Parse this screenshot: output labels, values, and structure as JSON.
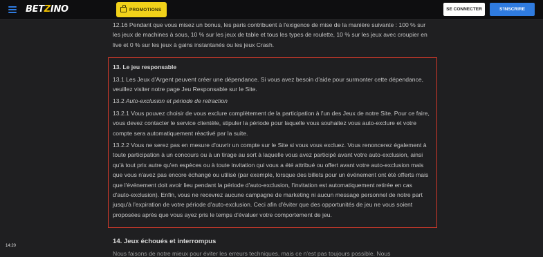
{
  "header": {
    "logo_main": "BET",
    "logo_accent": "Z",
    "logo_rest": "INO",
    "promo_label": "PROMOTIONS",
    "login_label": "SE CONNECTER",
    "signup_label": "S'INSCRIRE",
    "colors": {
      "accent_blue": "#2f7be0",
      "promo_yellow": "#f2d21a",
      "highlight_red": "#d63a2b"
    }
  },
  "content": {
    "p_12_16": "12.16 Pendant que vous misez un bonus, les paris contribuent à l'exigence de mise de la manière suivante : 100 % sur les jeux de machines à sous, 10 % sur les jeux de table et tous les types de roulette, 10 % sur les jeux avec croupier en live et 0 % sur les jeux à gains instantanés ou les jeux Crash.",
    "h_13": "13. Le jeu responsable",
    "p_13_1": "13.1 Les Jeux d'Argent peuvent créer une dépendance. Si vous avez besoin d'aide pour surmonter cette dépendance, veuillez visiter notre page Jeu Responsable sur le Site.",
    "h_13_2_num": "13.2",
    "h_13_2": "Auto-exclusion et période de retraction",
    "p_13_2_1": "13.2.1 Vous pouvez choisir de vous exclure complètement de la participation à l'un des Jeux de notre Site. Pour ce faire, vous devez contacter le service clientèle, stipuler la période pour laquelle vous souhaitez vous auto-exclure et votre compte sera automatiquement réactivé par la suite.",
    "p_13_2_2": "13.2.2 Vous ne serez pas en mesure d'ouvrir un compte sur le Site si vous vous excluez. Vous renoncerez également à toute participation à un concours ou à un tirage au sort à laquelle vous avez participé avant votre auto-exclusion, ainsi qu'à tout prix autre qu'en espèces ou à toute invitation qui vous a été attribué ou offert avant votre auto-exclusion mais que vous n'avez pas encore échangé ou utilisé (par exemple, lorsque des billets pour un événement ont été offerts mais que l'événement doit avoir lieu pendant la période d'auto-exclusion, l'invitation est automatiquement retirée en cas d'auto-exclusion). Enfin, vous ne recevrez aucune campagne de marketing ni aucun message personnel de notre part jusqu'à l'expiration de votre période d'auto-exclusion. Ceci afin d'éviter que des opportunités de jeu ne vous soient proposées après que vous ayez pris le temps d'évaluer votre comportement de jeu.",
    "h_14": "14. Jeux échoués et interrompus",
    "p_14_partial": "Nous faisons de notre mieux pour éviter les erreurs techniques, mais ce n'est pas toujours possible. Nous"
  },
  "status": {
    "time": "14:20"
  }
}
